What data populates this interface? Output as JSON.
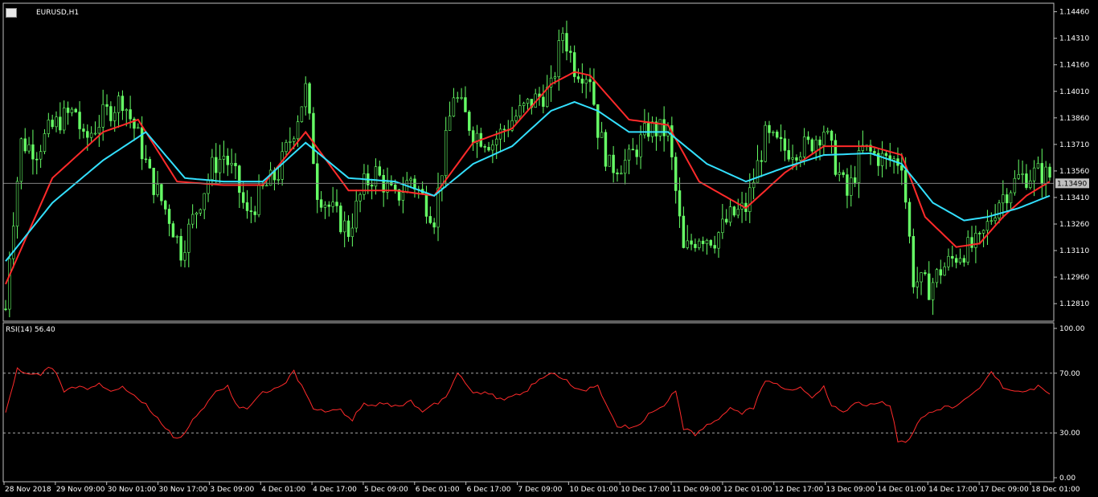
{
  "window": {
    "title": "EURUSD,H1",
    "icons": [
      "window-icon",
      "flag-icon"
    ]
  },
  "colors": {
    "background": "#000000",
    "bull": "#66ff66",
    "bear": "#66ff66",
    "ma_fast": "#ff2a2a",
    "ma_slow": "#33e0ff",
    "grid": "#808080",
    "rsi": "#ff2a2a",
    "price_tag": "#c0c0c0"
  },
  "price_axis": {
    "ticks": [
      "1.14460",
      "1.14310",
      "1.14160",
      "1.14010",
      "1.13860",
      "1.13710",
      "1.13560",
      "1.13410",
      "1.13260",
      "1.13110",
      "1.12960",
      "1.12810"
    ],
    "current": "1.13490",
    "min": 1.1272,
    "max": 1.1449
  },
  "rsi": {
    "title": "RSI(14) 56.40",
    "ticks": [
      "100.00",
      "70.00",
      "30.00",
      "0.00"
    ],
    "levels": [
      70,
      30
    ]
  },
  "time_axis": [
    "28 Nov 2018",
    "29 Nov 09:00",
    "30 Nov 01:00",
    "30 Nov 17:00",
    "3 Dec 09:00",
    "4 Dec 01:00",
    "4 Dec 17:00",
    "5 Dec 09:00",
    "6 Dec 01:00",
    "6 Dec 17:00",
    "7 Dec 09:00",
    "10 Dec 01:00",
    "10 Dec 17:00",
    "11 Dec 09:00",
    "12 Dec 01:00",
    "12 Dec 17:00",
    "13 Dec 09:00",
    "14 Dec 01:00",
    "14 Dec 17:00",
    "17 Dec 09:00",
    "18 Dec 01:00"
  ],
  "chart_data": {
    "type": "line",
    "title": "EURUSD,H1",
    "price_path": [
      [
        0,
        1.1278
      ],
      [
        1,
        1.131
      ],
      [
        4,
        1.1372
      ],
      [
        8,
        1.1368
      ],
      [
        11,
        1.1378
      ],
      [
        14,
        1.1385
      ],
      [
        18,
        1.139
      ],
      [
        20,
        1.1372
      ],
      [
        25,
        1.1387
      ],
      [
        30,
        1.1397
      ],
      [
        34,
        1.1375
      ],
      [
        37,
        1.1353
      ],
      [
        42,
        1.133
      ],
      [
        45,
        1.1311
      ],
      [
        50,
        1.134
      ],
      [
        53,
        1.1358
      ],
      [
        56,
        1.1365
      ],
      [
        59,
        1.1352
      ],
      [
        62,
        1.133
      ],
      [
        66,
        1.1345
      ],
      [
        70,
        1.1355
      ],
      [
        74,
        1.138
      ],
      [
        77,
        1.1402
      ],
      [
        80,
        1.1345
      ],
      [
        85,
        1.133
      ],
      [
        88,
        1.1322
      ],
      [
        92,
        1.1348
      ],
      [
        95,
        1.1355
      ],
      [
        100,
        1.134
      ],
      [
        104,
        1.1352
      ],
      [
        110,
        1.133
      ],
      [
        115,
        1.14
      ],
      [
        120,
        1.1378
      ],
      [
        125,
        1.1372
      ],
      [
        130,
        1.1385
      ],
      [
        135,
        1.1395
      ],
      [
        140,
        1.1402
      ],
      [
        143,
        1.1435
      ],
      [
        146,
        1.1415
      ],
      [
        150,
        1.141
      ],
      [
        152,
        1.138
      ],
      [
        155,
        1.1358
      ],
      [
        160,
        1.1362
      ],
      [
        165,
        1.138
      ],
      [
        170,
        1.1378
      ],
      [
        174,
        1.131
      ],
      [
        178,
        1.132
      ],
      [
        182,
        1.1318
      ],
      [
        186,
        1.133
      ],
      [
        190,
        1.1335
      ],
      [
        195,
        1.1375
      ],
      [
        200,
        1.1368
      ],
      [
        206,
        1.137
      ],
      [
        210,
        1.138
      ],
      [
        213,
        1.136
      ],
      [
        216,
        1.1342
      ],
      [
        220,
        1.1368
      ],
      [
        226,
        1.1362
      ],
      [
        230,
        1.1362
      ],
      [
        233,
        1.1295
      ],
      [
        237,
        1.129
      ],
      [
        240,
        1.13
      ],
      [
        245,
        1.131
      ],
      [
        250,
        1.1315
      ],
      [
        255,
        1.134
      ],
      [
        260,
        1.1352
      ],
      [
        265,
        1.1355
      ],
      [
        268,
        1.1353
      ]
    ],
    "series": [
      {
        "values_path": [
          [
            0,
            1.1292
          ],
          [
            12,
            1.1352
          ],
          [
            25,
            1.1378
          ],
          [
            34,
            1.1385
          ],
          [
            44,
            1.135
          ],
          [
            56,
            1.1348
          ],
          [
            66,
            1.1348
          ],
          [
            77,
            1.1378
          ],
          [
            88,
            1.1345
          ],
          [
            100,
            1.1345
          ],
          [
            110,
            1.1342
          ],
          [
            120,
            1.1372
          ],
          [
            130,
            1.138
          ],
          [
            140,
            1.1405
          ],
          [
            146,
            1.1412
          ],
          [
            150,
            1.141
          ],
          [
            160,
            1.1385
          ],
          [
            170,
            1.1382
          ],
          [
            178,
            1.135
          ],
          [
            190,
            1.1335
          ],
          [
            200,
            1.1355
          ],
          [
            210,
            1.137
          ],
          [
            222,
            1.137
          ],
          [
            230,
            1.1365
          ],
          [
            236,
            1.133
          ],
          [
            244,
            1.1313
          ],
          [
            250,
            1.1315
          ],
          [
            256,
            1.133
          ],
          [
            262,
            1.1342
          ],
          [
            268,
            1.135
          ]
        ]
      },
      {
        "values_path": [
          [
            0,
            1.1305
          ],
          [
            12,
            1.1338
          ],
          [
            25,
            1.1362
          ],
          [
            36,
            1.1378
          ],
          [
            46,
            1.1352
          ],
          [
            56,
            1.135
          ],
          [
            66,
            1.135
          ],
          [
            77,
            1.1372
          ],
          [
            88,
            1.1352
          ],
          [
            100,
            1.135
          ],
          [
            110,
            1.1342
          ],
          [
            120,
            1.136
          ],
          [
            130,
            1.137
          ],
          [
            140,
            1.139
          ],
          [
            146,
            1.1395
          ],
          [
            152,
            1.139
          ],
          [
            160,
            1.1378
          ],
          [
            170,
            1.1378
          ],
          [
            180,
            1.136
          ],
          [
            190,
            1.135
          ],
          [
            200,
            1.1358
          ],
          [
            210,
            1.1365
          ],
          [
            222,
            1.1366
          ],
          [
            230,
            1.136
          ],
          [
            238,
            1.1338
          ],
          [
            246,
            1.1328
          ],
          [
            252,
            1.133
          ],
          [
            260,
            1.1335
          ],
          [
            268,
            1.1342
          ]
        ]
      }
    ],
    "rsi_path": [
      [
        0,
        44
      ],
      [
        3,
        72
      ],
      [
        6,
        69
      ],
      [
        9,
        70
      ],
      [
        11,
        74
      ],
      [
        13,
        70
      ],
      [
        15,
        58
      ],
      [
        18,
        62
      ],
      [
        21,
        60
      ],
      [
        24,
        62
      ],
      [
        27,
        58
      ],
      [
        30,
        60
      ],
      [
        33,
        55
      ],
      [
        36,
        48
      ],
      [
        40,
        36
      ],
      [
        43,
        27
      ],
      [
        45,
        26
      ],
      [
        48,
        38
      ],
      [
        51,
        48
      ],
      [
        54,
        58
      ],
      [
        57,
        60
      ],
      [
        59,
        50
      ],
      [
        62,
        46
      ],
      [
        65,
        55
      ],
      [
        68,
        58
      ],
      [
        71,
        62
      ],
      [
        74,
        72
      ],
      [
        76,
        62
      ],
      [
        79,
        46
      ],
      [
        82,
        44
      ],
      [
        86,
        46
      ],
      [
        89,
        38
      ],
      [
        92,
        50
      ],
      [
        95,
        48
      ],
      [
        98,
        50
      ],
      [
        101,
        48
      ],
      [
        104,
        52
      ],
      [
        107,
        44
      ],
      [
        110,
        50
      ],
      [
        113,
        54
      ],
      [
        116,
        70
      ],
      [
        119,
        60
      ],
      [
        122,
        56
      ],
      [
        125,
        56
      ],
      [
        128,
        52
      ],
      [
        131,
        56
      ],
      [
        134,
        58
      ],
      [
        137,
        66
      ],
      [
        140,
        70
      ],
      [
        143,
        66
      ],
      [
        146,
        60
      ],
      [
        149,
        58
      ],
      [
        152,
        62
      ],
      [
        154,
        50
      ],
      [
        157,
        34
      ],
      [
        160,
        33
      ],
      [
        163,
        36
      ],
      [
        166,
        44
      ],
      [
        169,
        48
      ],
      [
        172,
        58
      ],
      [
        174,
        34
      ],
      [
        177,
        30
      ],
      [
        180,
        34
      ],
      [
        183,
        40
      ],
      [
        186,
        46
      ],
      [
        189,
        44
      ],
      [
        192,
        48
      ],
      [
        195,
        66
      ],
      [
        198,
        62
      ],
      [
        201,
        58
      ],
      [
        204,
        60
      ],
      [
        207,
        54
      ],
      [
        210,
        60
      ],
      [
        212,
        48
      ],
      [
        215,
        44
      ],
      [
        218,
        50
      ],
      [
        221,
        48
      ],
      [
        224,
        50
      ],
      [
        227,
        48
      ],
      [
        229,
        24
      ],
      [
        232,
        26
      ],
      [
        235,
        40
      ],
      [
        238,
        44
      ],
      [
        241,
        48
      ],
      [
        244,
        48
      ],
      [
        247,
        54
      ],
      [
        250,
        60
      ],
      [
        253,
        71
      ],
      [
        256,
        60
      ],
      [
        259,
        58
      ],
      [
        262,
        58
      ],
      [
        265,
        62
      ],
      [
        268,
        56
      ]
    ],
    "xlabel": "",
    "ylabel": "",
    "ylim": [
      1.1272,
      1.1449
    ],
    "x_count": 269,
    "grid": false,
    "legend": "none"
  }
}
